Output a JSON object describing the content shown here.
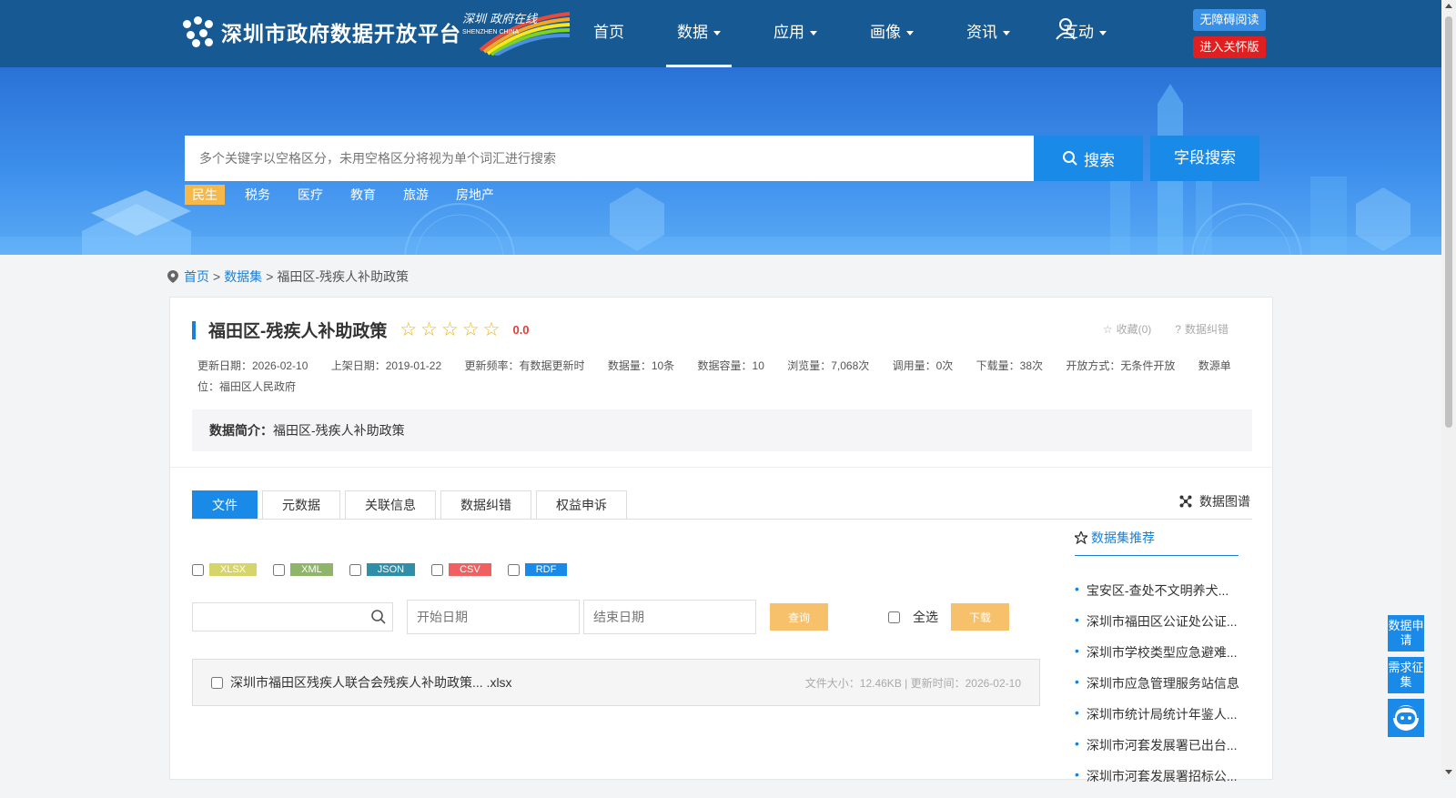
{
  "header": {
    "logo_text": "深圳市政府数据开放平台",
    "badge_script": "深圳 政府在线",
    "badge_sub": "SHENZHEN CHINA",
    "nav": [
      {
        "label": "首页",
        "dropdown": false
      },
      {
        "label": "数据",
        "dropdown": true,
        "active": true
      },
      {
        "label": "应用",
        "dropdown": true
      },
      {
        "label": "画像",
        "dropdown": true
      },
      {
        "label": "资讯",
        "dropdown": true
      },
      {
        "label": "互动",
        "dropdown": true
      }
    ],
    "accessibility_label": "无障碍阅读",
    "care_mode_label": "进入关怀版"
  },
  "search": {
    "placeholder": "多个关键字以空格区分，未用空格区分将视为单个词汇进行搜索",
    "search_button": "搜索",
    "field_search_button": "字段搜索",
    "hot_tags": [
      "民生",
      "税务",
      "医疗",
      "教育",
      "旅游",
      "房地产"
    ]
  },
  "breadcrumb": {
    "home": "首页",
    "datasets": "数据集",
    "current": "福田区-残疾人补助政策",
    "sep": ">"
  },
  "dataset": {
    "title": "福田区-残疾人补助政策",
    "rating": 0,
    "score": "0.0",
    "favorite": "收藏(0)",
    "report": "数据纠错",
    "meta": [
      "更新日期：2026-02-10",
      "上架日期：2019-01-22",
      "更新频率：有数据更新时",
      "数据量：10条",
      "数据容量：10",
      "浏览量：7,068次",
      "调用量：0次",
      "下载量：38次",
      "开放方式：无条件开放",
      "数源单位：福田区人民政府"
    ],
    "summary_label": "数据简介：",
    "summary_text": "福田区-残疾人补助政策"
  },
  "tabs": [
    "文件",
    "元数据",
    "关联信息",
    "数据纠错",
    "权益申诉"
  ],
  "graph_link": "数据图谱",
  "formats": [
    {
      "label": "XLSX",
      "color": "#d6d56a"
    },
    {
      "label": "XML",
      "color": "#8fb56b"
    },
    {
      "label": "JSON",
      "color": "#2f8fa8"
    },
    {
      "label": "CSV",
      "color": "#f06060"
    },
    {
      "label": "RDF",
      "color": "#1a8ae8"
    }
  ],
  "filters": {
    "start_date_placeholder": "开始日期",
    "end_date_placeholder": "结束日期",
    "query_button": "查询",
    "select_all": "全选",
    "download_button": "下载"
  },
  "files": [
    {
      "name": "深圳市福田区残疾人联合会残疾人补助政策... .xlsx",
      "meta": "文件大小：12.46KB | 更新时间：2026-02-10"
    }
  ],
  "recommend": {
    "title": "数据集推荐",
    "items": [
      "宝安区-查处不文明养犬...",
      "深圳市福田区公证处公证...",
      "深圳市学校类型应急避难...",
      "深圳市应急管理服务站信息",
      "深圳市统计局统计年鉴人...",
      "深圳市河套发展署已出台...",
      "深圳市河套发展署招标公..."
    ]
  },
  "float": {
    "data_apply": "数据申请",
    "demand": "需求征集"
  }
}
